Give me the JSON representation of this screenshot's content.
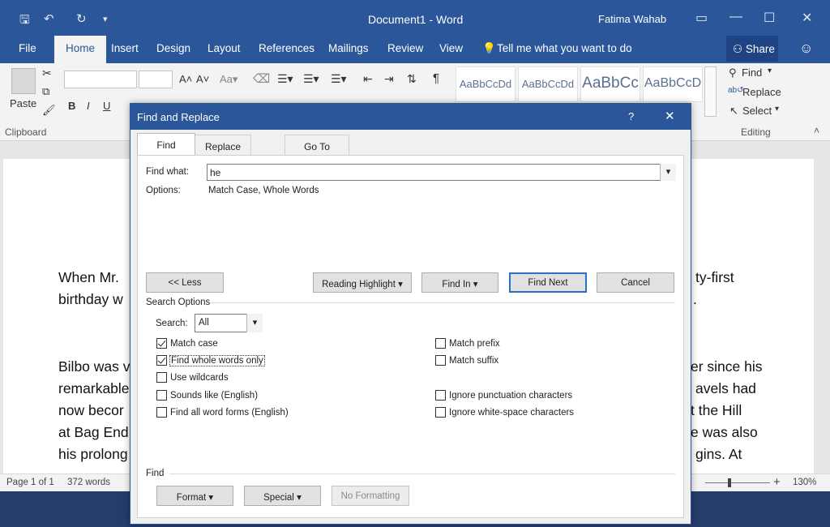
{
  "window": {
    "title": "Document1  -  Word",
    "user": "Fatima Wahab"
  },
  "ribbon_tabs": [
    "File",
    "Home",
    "Insert",
    "Design",
    "Layout",
    "References",
    "Mailings",
    "Review",
    "View"
  ],
  "tell_me": "Tell me what you want to do",
  "share_label": "Share",
  "ribbon": {
    "paste": "Paste",
    "clipboard_group": "Clipboard",
    "editing_group": "Editing",
    "find": "Find",
    "replace": "Replace",
    "select": "Select",
    "styles": [
      "AaBbCcDd",
      "AaBbCcDd",
      "AaBbCc",
      "AaBbCcD"
    ]
  },
  "document": {
    "lines": [
      {
        "left": "When Mr.",
        "right": "ty-first"
      },
      {
        "left": "birthday w",
        "right": "."
      },
      {
        "left": "Bilbo was v",
        "right": "er since his"
      },
      {
        "left": "remarkable",
        "right": "avels had"
      },
      {
        "left": "now becor",
        "right": "t the Hill"
      },
      {
        "left": "at Bag End",
        "right": "e was also"
      },
      {
        "left": "his prolong",
        "right": "gins. At"
      }
    ]
  },
  "status": {
    "page": "Page 1 of 1",
    "words": "372 words",
    "zoom": "130%"
  },
  "dialog": {
    "title": "Find and Replace",
    "help": "?",
    "tabs": [
      "Find",
      "Replace",
      "Go To"
    ],
    "find_what_label": "Find what:",
    "find_what_value": "he",
    "options_label": "Options:",
    "options_value": "Match Case, Whole Words",
    "buttons": {
      "less": "<< Less",
      "reading_highlight": "Reading Highlight",
      "find_in": "Find In",
      "find_next": "Find Next",
      "cancel": "Cancel"
    },
    "search_options_label": "Search Options",
    "search_label": "Search:",
    "search_value": "All",
    "checkboxes_left": [
      {
        "label": "Match case",
        "checked": true
      },
      {
        "label": "Find whole words only",
        "checked": true
      },
      {
        "label": "Use wildcards",
        "checked": false
      },
      {
        "label": "Sounds like (English)",
        "checked": false
      },
      {
        "label": "Find all word forms (English)",
        "checked": false
      }
    ],
    "checkboxes_right": [
      {
        "label": "Match prefix",
        "checked": false
      },
      {
        "label": "Match suffix",
        "checked": false
      },
      {
        "label": "Ignore punctuation characters",
        "checked": false
      },
      {
        "label": "Ignore white-space characters",
        "checked": false
      }
    ],
    "find_section_label": "Find",
    "format_button": "Format",
    "special_button": "Special",
    "no_formatting_button": "No Formatting"
  },
  "colors": {
    "accent": "#2b579a",
    "primary_button_border": "#2d6fc0"
  }
}
